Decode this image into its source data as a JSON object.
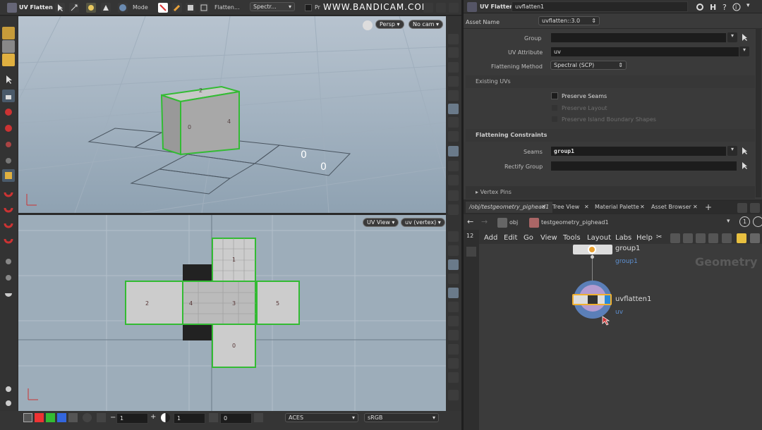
{
  "app": {
    "title": "UV Flatten",
    "mode_label": "Mode",
    "menu_flatten": "Flatten...",
    "method_short": "Spectr...",
    "pr_label": "Pr",
    "watermark": "WWW.BANDICAM.COM"
  },
  "viewport3d": {
    "persp": "Persp",
    "cam": "No cam",
    "face_labels": [
      "2",
      "0",
      "4"
    ]
  },
  "uvview": {
    "view_btn": "UV View",
    "attr_btn": "uv (vertex)",
    "face_labels": [
      "1",
      "2",
      "4",
      "3",
      "5",
      "0"
    ]
  },
  "bottombar": {
    "field1": "1",
    "field2": "1",
    "field3": "0",
    "colorspace": "ACES",
    "display": "sRGB",
    "colors": [
      "#ff3333",
      "#33cc33",
      "#3366ff"
    ]
  },
  "params": {
    "node_type": "UV Flatten",
    "node_name": "uvflatten1",
    "asset_name_label": "Asset Name",
    "asset_name": "uvflatten::3.0",
    "group_label": "Group",
    "group_value": "",
    "uvattr_label": "UV Attribute",
    "uvattr_value": "uv",
    "method_label": "Flattening Method",
    "method_value": "Spectral (SCP)",
    "existing_uvs": "Existing UVs",
    "preserve_seams": "Preserve Seams",
    "preserve_layout": "Preserve Layout",
    "preserve_island": "Preserve Island Boundary Shapes",
    "constraints": "Flattening Constraints",
    "seams_label": "Seams",
    "seams_value": "group1",
    "rectify_label": "Rectify Group",
    "rectify_value": "",
    "vertex_pins": "Vertex Pins"
  },
  "network": {
    "tabs": [
      "/obj/testgeometry_pighead1",
      "Tree View",
      "Material Palette",
      "Asset Browser"
    ],
    "path_obj": "obj",
    "path_node": "testgeometry_pighead1",
    "menu": [
      "Add",
      "Edit",
      "Go",
      "View",
      "Tools",
      "Layout",
      "Labs",
      "Help"
    ],
    "context_label": "Geometry",
    "node1_name": "group1",
    "node1_sub": "group1",
    "node2_name": "uvflatten1",
    "node2_sub": "uv"
  }
}
